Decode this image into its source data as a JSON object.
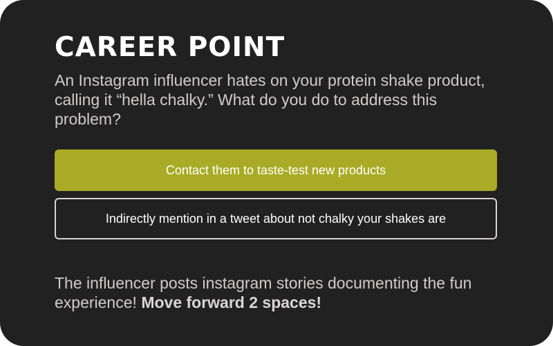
{
  "card": {
    "title": "CAREER POINT",
    "question": "An Instagram influencer hates on your protein shake product, calling it “hella chalky.” What do you do to address this problem?",
    "options": [
      {
        "label": "Contact them to taste-test new products",
        "selected": true
      },
      {
        "label": "Indirectly mention in a tweet about not chalky your shakes are",
        "selected": false
      }
    ],
    "result": {
      "text": "The influencer posts instagram stories documenting the fun experience! ",
      "emphasis": "Move forward 2 spaces!"
    }
  },
  "colors": {
    "background": "#222121",
    "selected_option": "#a9ab26",
    "option_border": "#d9d4d4",
    "text": "#cfcbcb"
  }
}
